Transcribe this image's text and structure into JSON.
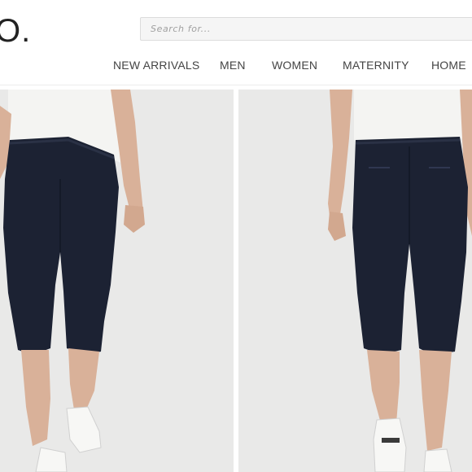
{
  "header": {
    "logo_text": "O.",
    "search": {
      "placeholder": "Search for...",
      "value": ""
    },
    "nav": [
      {
        "label": "NEW ARRIVALS"
      },
      {
        "label": "MEN"
      },
      {
        "label": "WOMEN"
      },
      {
        "label": "MATERNITY"
      },
      {
        "label": "HOME"
      }
    ]
  },
  "gallery": {
    "images": [
      {
        "subject": "navy cropped pants, front view",
        "shoe": "white sneakers"
      },
      {
        "subject": "navy cropped pants, back view",
        "shoe": "white sneakers"
      }
    ],
    "colors": {
      "pants": "#1c2233",
      "backdrop": "#e9e9e8",
      "top": "#f4f4f2",
      "skin": "#d9b199"
    }
  }
}
